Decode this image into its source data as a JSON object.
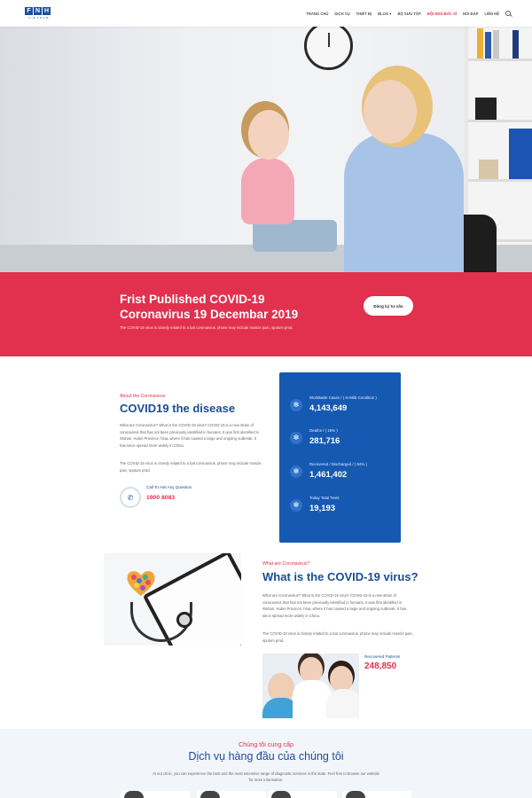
{
  "header": {
    "logo_letters": [
      "F",
      "N",
      "H"
    ],
    "logo_sub": "VIETNAM",
    "nav": [
      {
        "label": "TRANG CHỦ",
        "active": false
      },
      {
        "label": "DỊCH VỤ",
        "active": false
      },
      {
        "label": "THIẾT BỊ",
        "active": false
      },
      {
        "label": "BLOG",
        "active": false
      },
      {
        "label": "BỘ SƯU TẬP",
        "active": false
      },
      {
        "label": "ĐỘI NGŨ BÁC SĨ",
        "active": true
      },
      {
        "label": "HỎI ĐÁP",
        "active": false
      },
      {
        "label": "LIÊN HỆ",
        "active": false
      }
    ],
    "search_icon": "search-icon"
  },
  "banner": {
    "title": "Frist Published COVID-19 Coronavirus 19 Decembar 2019",
    "description": "The COVID-19 virus is closely related to a bat coronavirus. phone may include muscle pain, sputum prod.",
    "cta": "Đăng ký tư vấn"
  },
  "about": {
    "tag": "About the Coronavirus",
    "title": "COVID19 the disease",
    "p1": "What are Coronavirus? What is the COVID-19 virus? COVID-19 is a new strain of coronavirus that has not been previously identified in humans. It was first identified in Wuhan, Hubei Province, hina, where it has caused a large and ongoing outbreak. It has since spread more widely in China.",
    "p2": "The COVID-19 virus is closely related to a bat coronavirus. phone may include muscle pain, sputum prod.",
    "call_label": "Call To Ask Any Question",
    "call_number": "1900 8083",
    "call_icon": "phone-icon"
  },
  "stats": [
    {
      "label": "Worldwide Cases / ( In Mild Condition )",
      "value": "4,143,649",
      "icon": "virus-icon"
    },
    {
      "label": "Deaths / ( 16% )",
      "value": "281,716",
      "icon": "virus-icon"
    },
    {
      "label": "Recovered / Discharged / ( 84% )",
      "value": "1,461,402",
      "icon": "virus-icon"
    },
    {
      "label": "Today Total Tests",
      "value": "19,193",
      "icon": "virus-icon"
    }
  ],
  "whatis": {
    "tag": "What are Coronavirus?",
    "title": "What is the COVID-19 virus?",
    "p1": "What are Coronavirus? What is the COVID-19 virus? COVID-19 is a new strain of coronavirus that has not been previously identified in humans. It was first identified in Wuhan, Hubei Province, hina, where it has caused a large and ongoing outbreak. It has since spread more widely in China.",
    "p2": "The COVID-19 virus is closely related to a bat coronavirus. phone may include muscle pain, sputum prod.",
    "recovered_label": "Recovered Patients",
    "recovered_value": "248,850"
  },
  "services": {
    "tag": "Chúng tôi cung cấp",
    "title": "Dịch vụ hàng đầu của chúng tôi",
    "description": "At our clinic, you can experience the best and the most extensive range of diagnostic services in the state. Feel free to browse our website for more information."
  },
  "colors": {
    "accent_red": "#e2304f",
    "brand_blue": "#1a4d96",
    "stats_blue": "#1659b2"
  }
}
